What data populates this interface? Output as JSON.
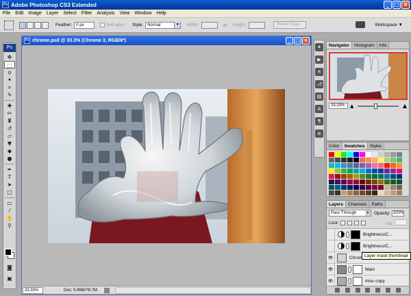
{
  "app": {
    "title": "Adobe Photoshop CS3 Extended",
    "logo_text": "Ps"
  },
  "menu": [
    "File",
    "Edit",
    "Image",
    "Layer",
    "Select",
    "Filter",
    "Analysis",
    "View",
    "Window",
    "Help"
  ],
  "options": {
    "feather_label": "Feather:",
    "feather_value": "0 px",
    "antialias_label": "Anti-alias",
    "style_label": "Style:",
    "style_value": "Normal",
    "width_label": "Width:",
    "height_label": "Height:",
    "refine_label": "Refine Edge...",
    "workspace_label": "Workspace ▼"
  },
  "document": {
    "title": "chrome.psd @ 33.3% (Chrome 3, RGB/8*)",
    "zoom": "33.33%",
    "doc_info": "Doc: 5.96M/79.7M"
  },
  "navigator": {
    "tabs": [
      "Navigator",
      "Histogram",
      "Info"
    ],
    "zoom": "33.33%",
    "zoom_level": 0.4
  },
  "swatches": {
    "tabs": [
      "Color",
      "Swatches",
      "Styles"
    ],
    "colors": [
      "#ff0000",
      "#ffff00",
      "#00ff00",
      "#00ffff",
      "#0000ff",
      "#ff00ff",
      "#ffffff",
      "#e6e6e6",
      "#cccccc",
      "#b3b3b3",
      "#999999",
      "#808080",
      "#666666",
      "#4d4d4d",
      "#333333",
      "#1a1a1a",
      "#000000",
      "#f26c4f",
      "#f68e55",
      "#fbaf5d",
      "#fff467",
      "#acd372",
      "#7cc576",
      "#3bb878",
      "#1abbb4",
      "#00bff3",
      "#438ccb",
      "#5574b9",
      "#605ca8",
      "#855fa8",
      "#a763a8",
      "#f06ea9",
      "#f26d7d",
      "#ed1c24",
      "#f26522",
      "#f7941d",
      "#fff200",
      "#8dc73f",
      "#39b54a",
      "#00a651",
      "#00a99d",
      "#00aeef",
      "#0072bc",
      "#0054a6",
      "#2e3192",
      "#662d91",
      "#92278f",
      "#ec008c",
      "#ed145b",
      "#9e0b0f",
      "#a0410d",
      "#a36209",
      "#aba000",
      "#598527",
      "#1a7b30",
      "#007236",
      "#00746b",
      "#0076a3",
      "#004b80",
      "#003471",
      "#1b1464",
      "#440e62",
      "#630460",
      "#9e005d",
      "#9e0039",
      "#790000",
      "#7b2e00",
      "#7d4900",
      "#827b00",
      "#406618",
      "#005e20",
      "#005826",
      "#005952",
      "#005b7f",
      "#003663",
      "#002157",
      "#0d004c",
      "#32004b",
      "#4b0049",
      "#7b0046",
      "#7a0026",
      "#c7b299",
      "#998675",
      "#736357",
      "#534741",
      "#37302d",
      "#c69c6d",
      "#a67c52",
      "#8c6239",
      "#754c24",
      "#603913",
      "#42210b",
      "#e8d6c1",
      "#d4b89a",
      "#bf9b76",
      "#a67e57"
    ]
  },
  "layers": {
    "tabs": [
      "Layers",
      "Channels",
      "Paths"
    ],
    "blend_mode": "Pass Through",
    "opacity_label": "Opacity:",
    "opacity_value": "100%",
    "lock_label": "Lock:",
    "fill_label": "Fill:",
    "items": [
      {
        "name": "Brightness/C..."
      },
      {
        "name": "Brightness/C..."
      },
      {
        "name": "Chrome 3"
      },
      {
        "name": "Main"
      },
      {
        "name": "misc copy"
      }
    ],
    "tooltip": "Layer mask thumbnail"
  }
}
